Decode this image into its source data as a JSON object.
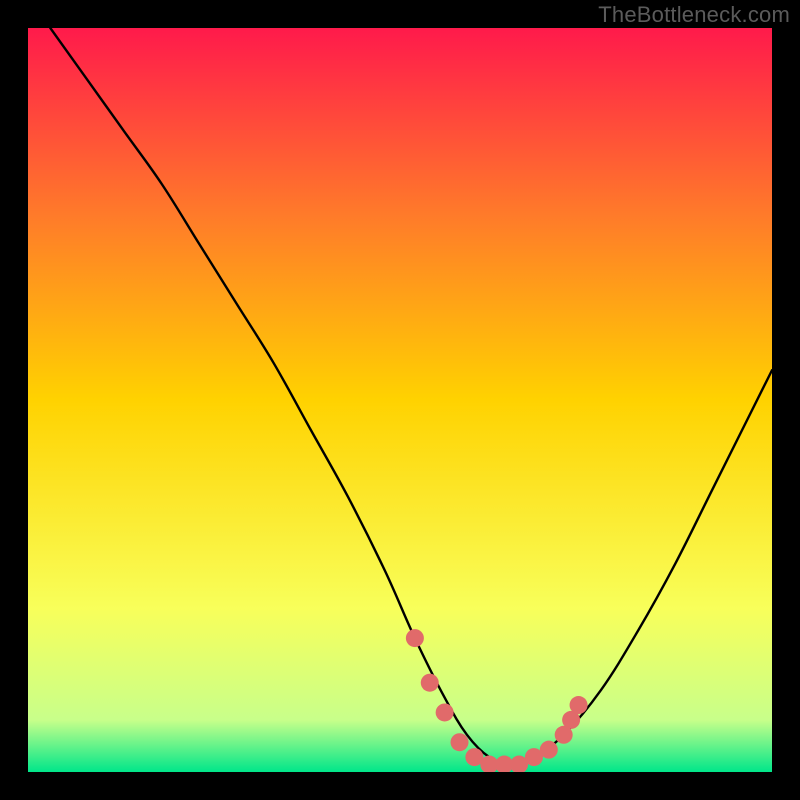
{
  "watermark": "TheBottleneck.com",
  "chart_data": {
    "type": "line",
    "title": "",
    "xlabel": "",
    "ylabel": "",
    "xlim": [
      0,
      100
    ],
    "ylim": [
      0,
      100
    ],
    "grid": false,
    "legend": false,
    "background_gradient": {
      "top": "#ff1a4b",
      "upper_mid": "#ff7a2a",
      "mid": "#ffd200",
      "lower_mid": "#f8ff5a",
      "near_bottom": "#c8ff8a",
      "bottom": "#00e68a"
    },
    "series": [
      {
        "name": "curve",
        "stroke": "#000000",
        "x": [
          3,
          8,
          13,
          18,
          23,
          28,
          33,
          38,
          43,
          48,
          52,
          56,
          59,
          62,
          65,
          68,
          72,
          77,
          82,
          87,
          92,
          97,
          100
        ],
        "y": [
          100,
          93,
          86,
          79,
          71,
          63,
          55,
          46,
          37,
          27,
          18,
          10,
          5,
          2,
          1,
          2,
          5,
          11,
          19,
          28,
          38,
          48,
          54
        ]
      }
    ],
    "highlight": {
      "name": "bottom-dots",
      "color": "#e16a6a",
      "points": [
        {
          "x": 52,
          "y": 18
        },
        {
          "x": 54,
          "y": 12
        },
        {
          "x": 56,
          "y": 8
        },
        {
          "x": 58,
          "y": 4
        },
        {
          "x": 60,
          "y": 2
        },
        {
          "x": 62,
          "y": 1
        },
        {
          "x": 64,
          "y": 1
        },
        {
          "x": 66,
          "y": 1
        },
        {
          "x": 68,
          "y": 2
        },
        {
          "x": 70,
          "y": 3
        },
        {
          "x": 72,
          "y": 5
        },
        {
          "x": 73,
          "y": 7
        },
        {
          "x": 74,
          "y": 9
        }
      ]
    }
  }
}
